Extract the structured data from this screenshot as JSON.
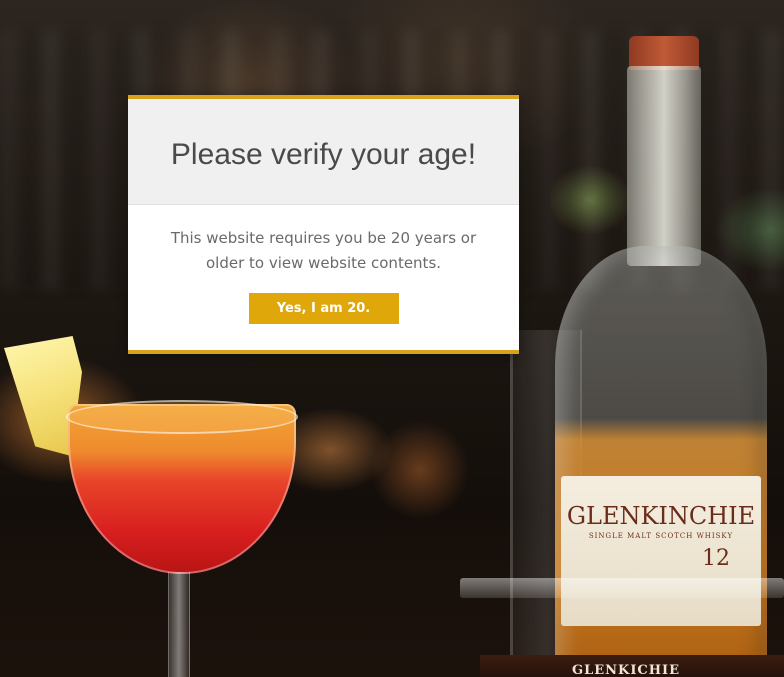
{
  "modal": {
    "title": "Please verify your age!",
    "message": "This website requires you be 20 years or older to view website contents.",
    "confirm_label": "Yes, I am 20."
  },
  "background": {
    "bottle_brand": "GLENKINCHIE",
    "bottle_subtitle": "SINGLE MALT SCOTCH WHISKY",
    "bottle_age": "12",
    "base_sign": "GLENKICHIE"
  },
  "colors": {
    "accent": "#e0a70a",
    "modal_border": "#d9a21b",
    "header_bg": "#f0f0f0",
    "title_text": "#4a4a4a",
    "body_text": "#6a6a6a"
  }
}
